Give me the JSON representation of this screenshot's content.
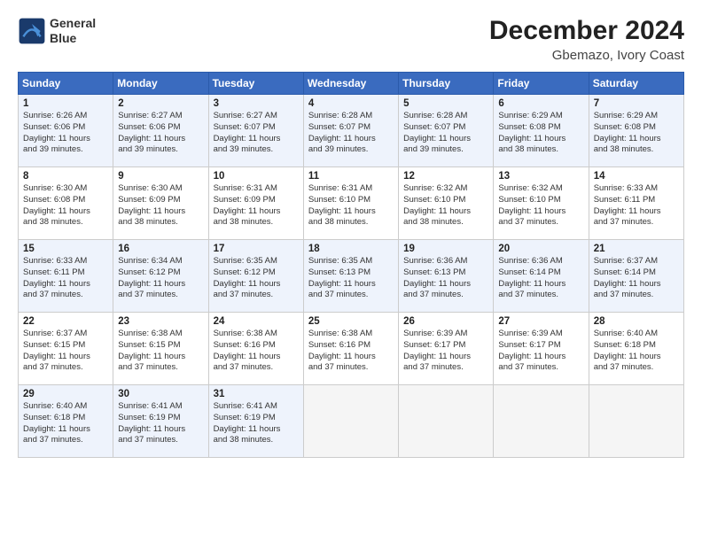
{
  "header": {
    "logo_line1": "General",
    "logo_line2": "Blue",
    "title": "December 2024",
    "subtitle": "Gbemazo, Ivory Coast"
  },
  "days_of_week": [
    "Sunday",
    "Monday",
    "Tuesday",
    "Wednesday",
    "Thursday",
    "Friday",
    "Saturday"
  ],
  "weeks": [
    [
      {
        "day": "1",
        "info": "Sunrise: 6:26 AM\nSunset: 6:06 PM\nDaylight: 11 hours\nand 39 minutes."
      },
      {
        "day": "2",
        "info": "Sunrise: 6:27 AM\nSunset: 6:06 PM\nDaylight: 11 hours\nand 39 minutes."
      },
      {
        "day": "3",
        "info": "Sunrise: 6:27 AM\nSunset: 6:07 PM\nDaylight: 11 hours\nand 39 minutes."
      },
      {
        "day": "4",
        "info": "Sunrise: 6:28 AM\nSunset: 6:07 PM\nDaylight: 11 hours\nand 39 minutes."
      },
      {
        "day": "5",
        "info": "Sunrise: 6:28 AM\nSunset: 6:07 PM\nDaylight: 11 hours\nand 39 minutes."
      },
      {
        "day": "6",
        "info": "Sunrise: 6:29 AM\nSunset: 6:08 PM\nDaylight: 11 hours\nand 38 minutes."
      },
      {
        "day": "7",
        "info": "Sunrise: 6:29 AM\nSunset: 6:08 PM\nDaylight: 11 hours\nand 38 minutes."
      }
    ],
    [
      {
        "day": "8",
        "info": "Sunrise: 6:30 AM\nSunset: 6:08 PM\nDaylight: 11 hours\nand 38 minutes."
      },
      {
        "day": "9",
        "info": "Sunrise: 6:30 AM\nSunset: 6:09 PM\nDaylight: 11 hours\nand 38 minutes."
      },
      {
        "day": "10",
        "info": "Sunrise: 6:31 AM\nSunset: 6:09 PM\nDaylight: 11 hours\nand 38 minutes."
      },
      {
        "day": "11",
        "info": "Sunrise: 6:31 AM\nSunset: 6:10 PM\nDaylight: 11 hours\nand 38 minutes."
      },
      {
        "day": "12",
        "info": "Sunrise: 6:32 AM\nSunset: 6:10 PM\nDaylight: 11 hours\nand 38 minutes."
      },
      {
        "day": "13",
        "info": "Sunrise: 6:32 AM\nSunset: 6:10 PM\nDaylight: 11 hours\nand 37 minutes."
      },
      {
        "day": "14",
        "info": "Sunrise: 6:33 AM\nSunset: 6:11 PM\nDaylight: 11 hours\nand 37 minutes."
      }
    ],
    [
      {
        "day": "15",
        "info": "Sunrise: 6:33 AM\nSunset: 6:11 PM\nDaylight: 11 hours\nand 37 minutes."
      },
      {
        "day": "16",
        "info": "Sunrise: 6:34 AM\nSunset: 6:12 PM\nDaylight: 11 hours\nand 37 minutes."
      },
      {
        "day": "17",
        "info": "Sunrise: 6:35 AM\nSunset: 6:12 PM\nDaylight: 11 hours\nand 37 minutes."
      },
      {
        "day": "18",
        "info": "Sunrise: 6:35 AM\nSunset: 6:13 PM\nDaylight: 11 hours\nand 37 minutes."
      },
      {
        "day": "19",
        "info": "Sunrise: 6:36 AM\nSunset: 6:13 PM\nDaylight: 11 hours\nand 37 minutes."
      },
      {
        "day": "20",
        "info": "Sunrise: 6:36 AM\nSunset: 6:14 PM\nDaylight: 11 hours\nand 37 minutes."
      },
      {
        "day": "21",
        "info": "Sunrise: 6:37 AM\nSunset: 6:14 PM\nDaylight: 11 hours\nand 37 minutes."
      }
    ],
    [
      {
        "day": "22",
        "info": "Sunrise: 6:37 AM\nSunset: 6:15 PM\nDaylight: 11 hours\nand 37 minutes."
      },
      {
        "day": "23",
        "info": "Sunrise: 6:38 AM\nSunset: 6:15 PM\nDaylight: 11 hours\nand 37 minutes."
      },
      {
        "day": "24",
        "info": "Sunrise: 6:38 AM\nSunset: 6:16 PM\nDaylight: 11 hours\nand 37 minutes."
      },
      {
        "day": "25",
        "info": "Sunrise: 6:38 AM\nSunset: 6:16 PM\nDaylight: 11 hours\nand 37 minutes."
      },
      {
        "day": "26",
        "info": "Sunrise: 6:39 AM\nSunset: 6:17 PM\nDaylight: 11 hours\nand 37 minutes."
      },
      {
        "day": "27",
        "info": "Sunrise: 6:39 AM\nSunset: 6:17 PM\nDaylight: 11 hours\nand 37 minutes."
      },
      {
        "day": "28",
        "info": "Sunrise: 6:40 AM\nSunset: 6:18 PM\nDaylight: 11 hours\nand 37 minutes."
      }
    ],
    [
      {
        "day": "29",
        "info": "Sunrise: 6:40 AM\nSunset: 6:18 PM\nDaylight: 11 hours\nand 37 minutes."
      },
      {
        "day": "30",
        "info": "Sunrise: 6:41 AM\nSunset: 6:19 PM\nDaylight: 11 hours\nand 37 minutes."
      },
      {
        "day": "31",
        "info": "Sunrise: 6:41 AM\nSunset: 6:19 PM\nDaylight: 11 hours\nand 38 minutes."
      },
      {
        "day": "",
        "info": ""
      },
      {
        "day": "",
        "info": ""
      },
      {
        "day": "",
        "info": ""
      },
      {
        "day": "",
        "info": ""
      }
    ]
  ]
}
